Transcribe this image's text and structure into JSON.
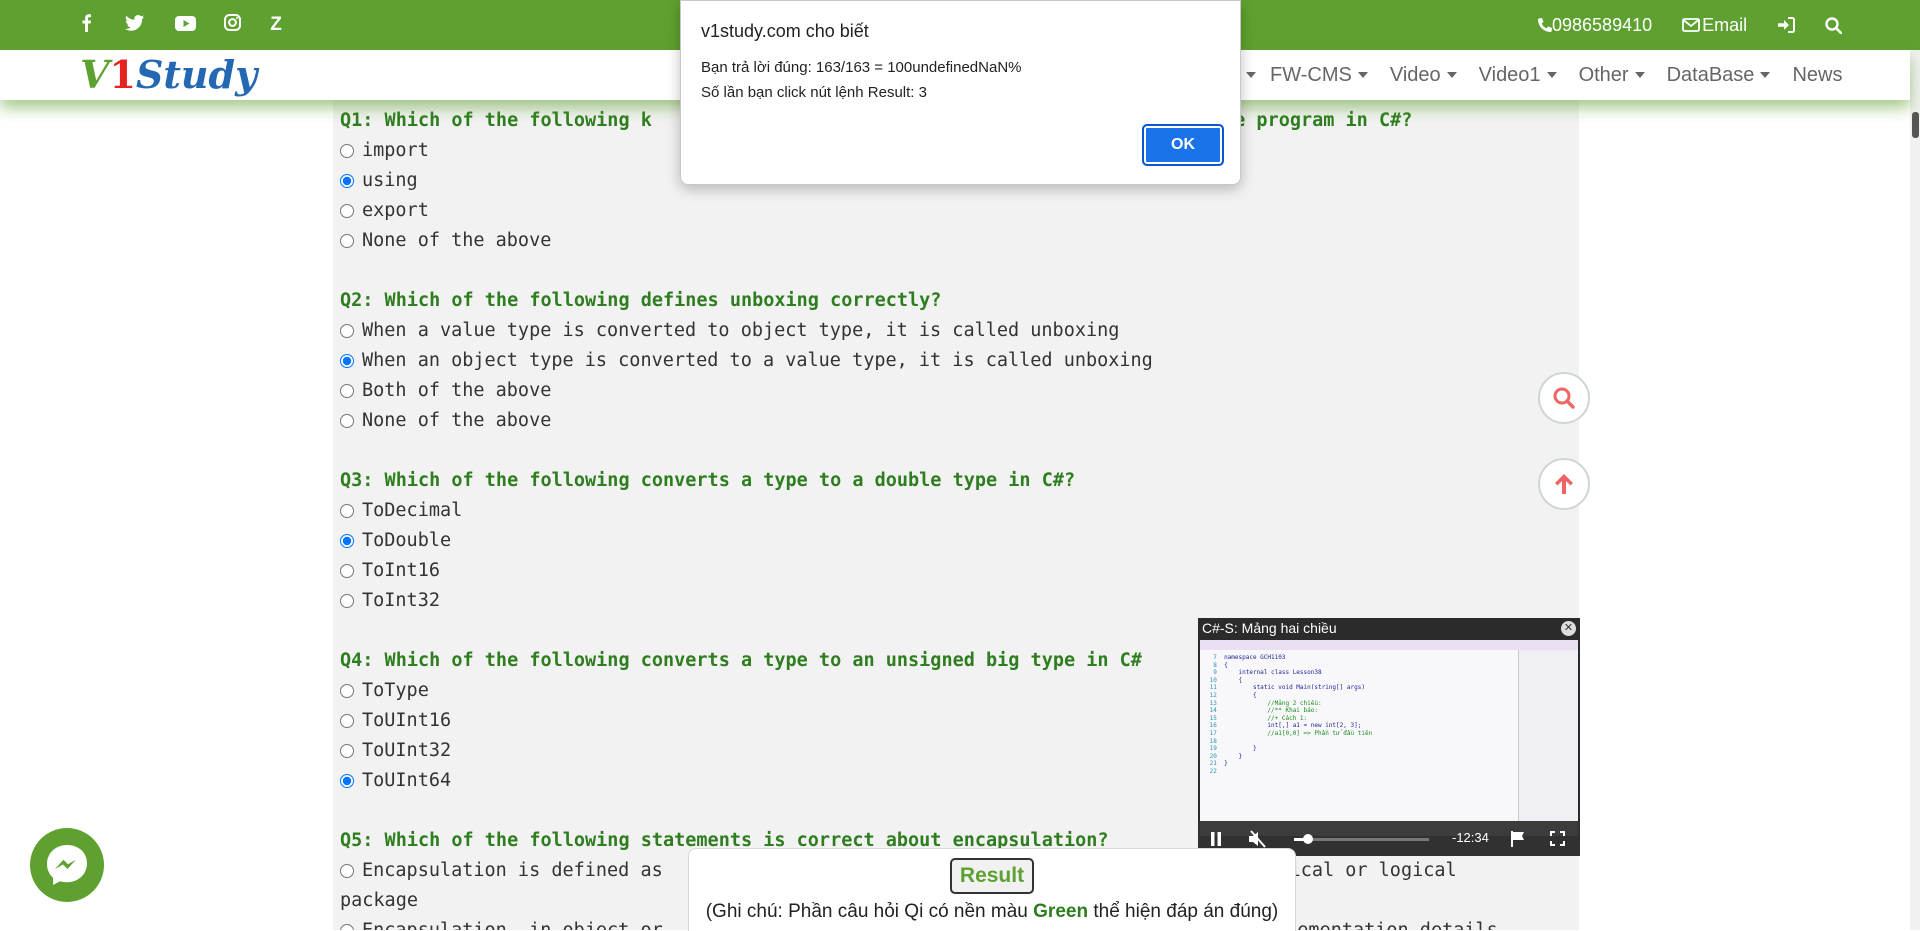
{
  "topbar": {
    "social_icons": [
      "facebook-icon",
      "twitter-icon",
      "youtube-icon",
      "instagram-icon",
      "zalo-icon"
    ],
    "zalo_glyph": "Z",
    "phone": "0986589410",
    "email_label": "Email"
  },
  "logo": {
    "part1": "V",
    "part2": "1",
    "part3": "Study"
  },
  "nav": {
    "items": [
      {
        "label": "FW-CMS"
      },
      {
        "label": "Video"
      },
      {
        "label": "Video1"
      },
      {
        "label": "Other"
      },
      {
        "label": "DataBase"
      },
      {
        "label": "News"
      }
    ]
  },
  "alert": {
    "title": "v1study.com cho biết",
    "line1": "Bạn trả lời đúng: 163/163 = 100undefinedNaN%",
    "line2": "Số lần bạn click nút lệnh Result: 3",
    "ok_label": "OK"
  },
  "questions": {
    "q1": {
      "title": "Q1: Which of the following k",
      "title_end": "the program in C#?",
      "options": [
        "import",
        "using",
        "export",
        "None of the above"
      ],
      "selected": 1
    },
    "q2": {
      "title": "Q2: Which of the following defines unboxing correctly?",
      "options": [
        "When a value type is converted to object type, it is called unboxing",
        "When an object type is converted to a value type, it is called unboxing",
        "Both of the above",
        "None of the above"
      ],
      "selected": 1
    },
    "q3": {
      "title": "Q3: Which of the following converts a type to a double type in C#?",
      "options": [
        "ToDecimal",
        "ToDouble",
        "ToInt16",
        "ToInt32"
      ],
      "selected": 1
    },
    "q4": {
      "title": "Q4: Which of the following converts a type to an unsigned big type in C#",
      "options": [
        "ToType",
        "ToUInt16",
        "ToUInt32",
        "ToUInt64"
      ],
      "selected": 3
    },
    "q5": {
      "title": "Q5: Which of the following statements is correct about encapsulation?",
      "option1_start": "Encapsulation is defined as",
      "option1_end": "a physical or logical",
      "option1_wrap": "package",
      "option2_start": "Encapsulation, in object or",
      "option2_end": "implementation details"
    }
  },
  "video": {
    "title": "C#-S: Mảng hai chiều",
    "time": "-12:34",
    "progress": 0.1,
    "code_lines": [
      {
        "n": "7",
        "t": "namespace GCH1103"
      },
      {
        "n": "8",
        "t": "{"
      },
      {
        "n": "9",
        "t": "    internal class Lesson38"
      },
      {
        "n": "10",
        "t": "    {"
      },
      {
        "n": "11",
        "t": "        static void Main(string[] args)"
      },
      {
        "n": "12",
        "t": "        {"
      },
      {
        "n": "13",
        "t": "            //Mảng 2 chiều:"
      },
      {
        "n": "14",
        "t": "            //** Khai báo:"
      },
      {
        "n": "15",
        "t": "            //+ Cách 1:"
      },
      {
        "n": "16",
        "t": "            int[,] a1 = new int[2, 3];"
      },
      {
        "n": "17",
        "t": "            //a1[0,0] => Phần tử đầu tiên"
      },
      {
        "n": "18",
        "t": ""
      },
      {
        "n": "19",
        "t": "        }"
      },
      {
        "n": "20",
        "t": "    }"
      },
      {
        "n": "21",
        "t": "}"
      },
      {
        "n": "22",
        "t": ""
      }
    ]
  },
  "result": {
    "button_label": "Result",
    "note_prefix": "(Ghi chú: Phần câu hỏi Qi có nền màu ",
    "note_green": "Green",
    "note_suffix": " thể hiện đáp án đúng)"
  },
  "colors": {
    "brand_green": "#5fa130",
    "question_green": "#2e7d1f",
    "ok_blue": "#1a73e8"
  }
}
